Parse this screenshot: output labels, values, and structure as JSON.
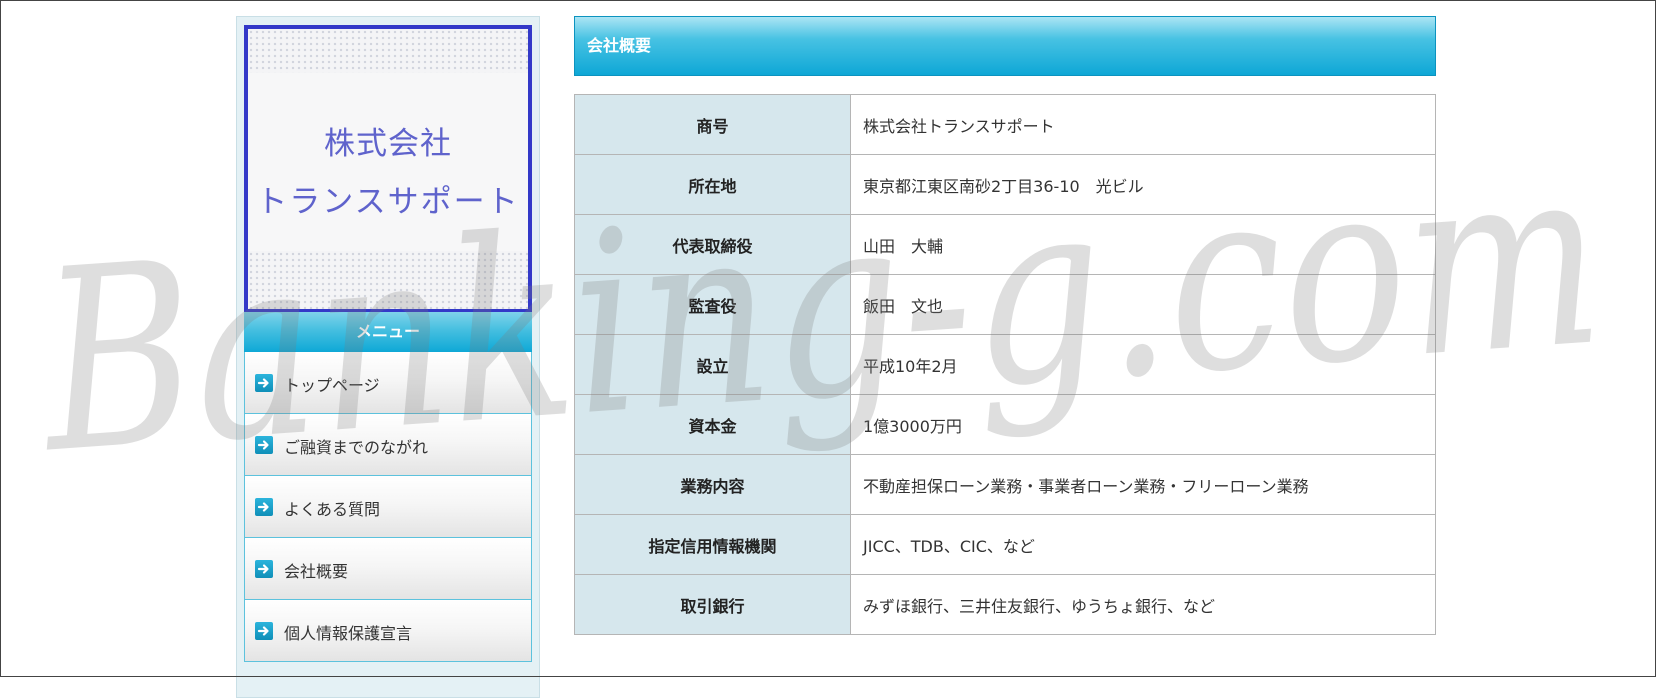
{
  "logo": {
    "line1": "株式会社",
    "line2": "トランスサポート"
  },
  "sidebar": {
    "menu_title": "メニュー",
    "items": [
      {
        "label": "トップページ"
      },
      {
        "label": "ご融資までのながれ"
      },
      {
        "label": "よくある質問"
      },
      {
        "label": "会社概要"
      },
      {
        "label": "個人情報保護宣言"
      }
    ]
  },
  "main": {
    "section_title": "会社概要",
    "rows": [
      {
        "key": "商号",
        "value": "株式会社トランスサポート"
      },
      {
        "key": "所在地",
        "value": "東京都江東区南砂2丁目36-10　光ビル"
      },
      {
        "key": "代表取締役",
        "value": "山田　大輔"
      },
      {
        "key": "監査役",
        "value": "飯田　文也"
      },
      {
        "key": "設立",
        "value": "平成10年2月"
      },
      {
        "key": "資本金",
        "value": "1億3000万円"
      },
      {
        "key": "業務内容",
        "value": "不動産担保ローン業務・事業者ローン業務・フリーローン業務"
      },
      {
        "key": "指定信用情報機関",
        "value": "JICC、TDB、CIC、など"
      },
      {
        "key": "取引銀行",
        "value": "みずほ銀行、三井住友銀行、ゆうちょ銀行、など"
      }
    ]
  },
  "watermark": {
    "text": "Banking-g.com"
  },
  "colors": {
    "accent": "#0ea7d6",
    "logo_border": "#3339c8",
    "key_cell_bg": "#d6e7ed"
  },
  "icons": {
    "menu_item_icon": "arrow-right-icon"
  }
}
